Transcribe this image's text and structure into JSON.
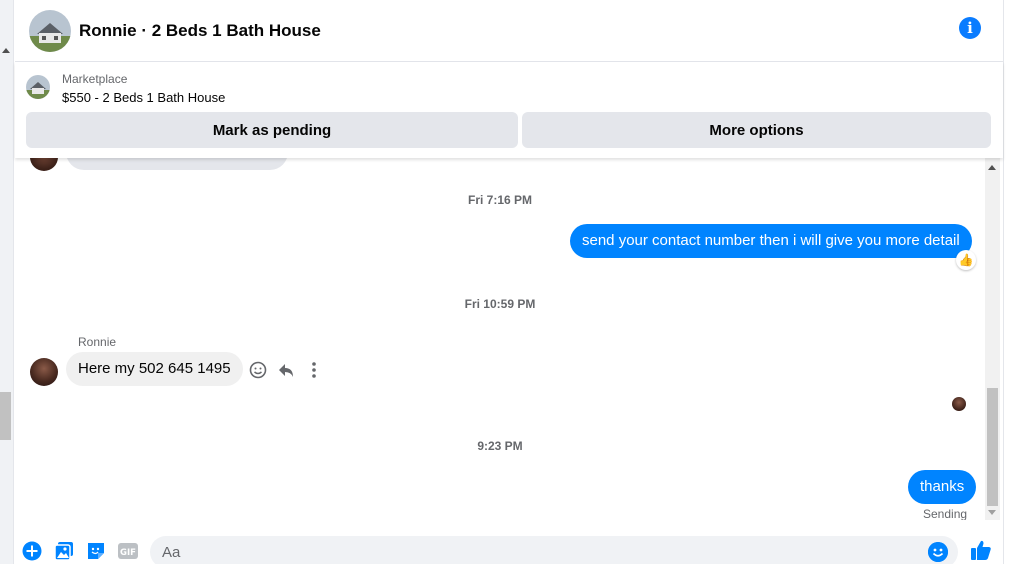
{
  "header": {
    "title": "Ronnie · 2 Beds 1 Bath House",
    "avatar_icon": "house-photo",
    "info_icon": "info-icon"
  },
  "marketplace": {
    "label": "Marketplace",
    "listing": "$550 - 2 Beds 1 Bath House",
    "buttons": {
      "mark_pending": "Mark as pending",
      "more_options": "More options"
    }
  },
  "messages": [
    {
      "type": "timestamp",
      "text": "Fri 7:16 PM"
    },
    {
      "type": "outgoing",
      "text": "send your contact number then i will give you more detail",
      "reaction": "👍"
    },
    {
      "type": "timestamp",
      "text": "Fri 10:59 PM"
    },
    {
      "type": "incoming",
      "sender": "Ronnie",
      "text": "Here my 502 645 1495"
    },
    {
      "type": "timestamp",
      "text": "9:23 PM"
    },
    {
      "type": "outgoing",
      "text": "thanks",
      "status": "Sending"
    }
  ],
  "composer": {
    "placeholder": "Aa",
    "value": "",
    "icons": [
      "plus-icon",
      "photo-icon",
      "sticker-icon",
      "gif-icon",
      "emoji-icon",
      "thumbs-up-icon"
    ],
    "gif_label": "GIF"
  },
  "colors": {
    "accent": "#0084ff",
    "outgoing_bubble": "#0084ff",
    "incoming_bubble": "#f0f0f0",
    "button_bg": "#e4e6eb",
    "muted_text": "#65676b"
  }
}
